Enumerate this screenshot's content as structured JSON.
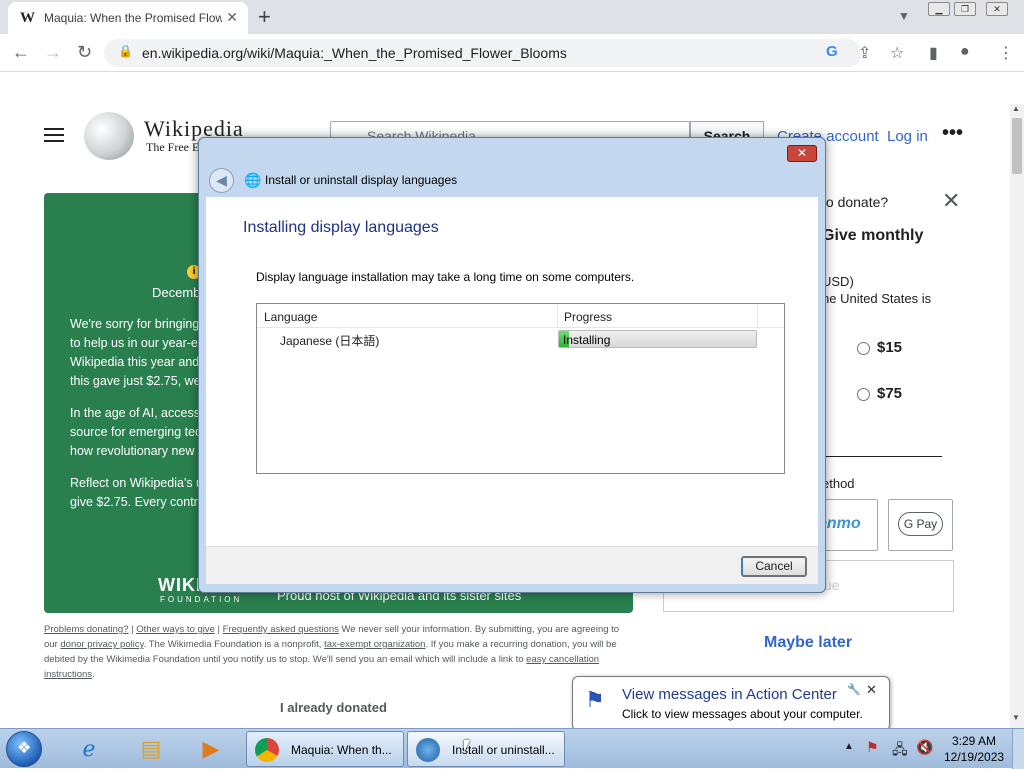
{
  "browser": {
    "tab_favicon": "W",
    "tab_title": "Maquia: When the Promised Flower Blooms",
    "tab_close": "✕",
    "new_tab": "+",
    "url": "en.wikipedia.org/wiki/Maquia:_When_the_Promised_Flower_Blooms",
    "icons": [
      "back-icon",
      "forward-icon",
      "reload-icon",
      "lock-icon",
      "google-icon",
      "share-icon",
      "star-icon",
      "sidepanel-icon",
      "profile-icon",
      "menu-icon"
    ]
  },
  "wiki": {
    "wordmark": "Wikipedia",
    "tagline": "The Free E",
    "search_placeholder": "Search Wikipedia",
    "search_button": "Search",
    "create_account": "Create account",
    "login": "Log in",
    "more": "•••"
  },
  "banner": {
    "date": "Decemb",
    "p1": [
      "We're sorry for bringing",
      "to help us in our year-er",
      "Wikipedia this year and",
      "this gave just $2.75, we'c"
    ],
    "p2": [
      "In the age of AI, access t",
      "source for emerging tech",
      "how revolutionary new s"
    ],
    "p3": [
      "Reflect on Wikipedia's us",
      "give $2.75. Every contrib"
    ],
    "wm_logo": "WIKIMEDIA",
    "wm_foundation": "FOUNDATION",
    "wm_host": "Proud host of Wikipedia and its sister sites"
  },
  "legal": {
    "problems": "Problems donating?",
    "other_ways": "Other ways to give",
    "faq": "Frequently asked questions",
    "sep": " | ",
    "text1": " We never sell your information. By submitting, you are agreeing to our ",
    "privacy": "donor privacy policy",
    "text2": ". The Wikimedia Foundation is a nonprofit, ",
    "taxexempt": "tax-exempt organization",
    "text3": ". If you make a recurring donation, you will be debited by the Wikimedia Foundation until you notify us to stop. We'll send you an email which will include a link to ",
    "cancellation": "easy cancellation instructions",
    "text4": ".",
    "already_donated": "I already donated"
  },
  "side": {
    "question": "to donate?",
    "close": "✕",
    "give_monthly": "Give monthly",
    "usd": "USD)",
    "us_is": "he United States is",
    "amount1": "$15",
    "amount2": "$75",
    "method": "ethod",
    "venmo": "enmo",
    "gpay": "G Pay",
    "continue": "ue",
    "maybe_later": "Maybe later"
  },
  "dialog": {
    "title": "Install or uninstall display languages",
    "close": "✕",
    "back": "◀",
    "heading": "Installing display languages",
    "description": "Display language installation may take a long time on some computers.",
    "col_language": "Language",
    "col_progress": "Progress",
    "row_language": "Japanese (日本語)",
    "row_status": "Installing",
    "progress_fraction": 0.05,
    "cancel": "Cancel"
  },
  "balloon": {
    "title": "View messages in Action Center",
    "text": "Click to view messages about your computer.",
    "close": "✕"
  },
  "taskbar": {
    "app1": "Maquia: When th...",
    "app2": "Install or uninstall...",
    "time": "3:29 AM",
    "date": "12/19/2023"
  },
  "colors": {
    "banner": "#2a7f4f",
    "link": "#3366cc",
    "progress": "#2fb12f"
  }
}
